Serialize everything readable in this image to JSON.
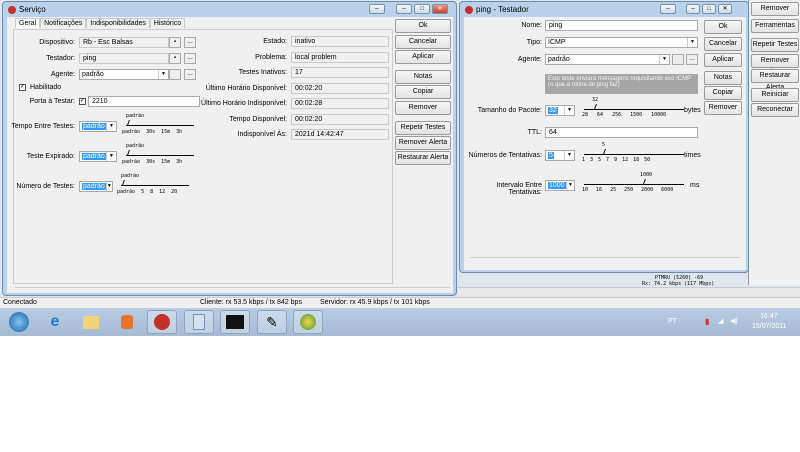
{
  "servico": {
    "title": "Serviço",
    "tabs": [
      "Geral",
      "Notificações",
      "Indisponibilidades",
      "Histórico"
    ],
    "dispositivo_label": "Dispositivo:",
    "dispositivo": "Rb - Esc Balsas",
    "testador_label": "Testador:",
    "testador": "ping",
    "agente_label": "Agente:",
    "agente": "padrão",
    "habilitado_label": "Habilitado",
    "porta_label": "Porta à Testar:",
    "porta": "2210",
    "tempo_label": "Tempo Entre Testes:",
    "tempo": "padrão",
    "tempo_marker": "padrão",
    "tempo_ticks": [
      "padrão",
      "30s",
      "15m",
      "3h"
    ],
    "expirado_label": "Teste Expirado:",
    "expirado": "padrão",
    "expirado_marker": "padrão",
    "expirado_ticks": [
      "padrão",
      "30s",
      "15m",
      "3h"
    ],
    "numero_label": "Número de Testes:",
    "numero": "padrão",
    "numero_marker": "padrão",
    "numero_ticks": [
      "padrão",
      "5",
      "8",
      "12",
      "20"
    ],
    "status": [
      {
        "label": "Estado:",
        "value": "inativo"
      },
      {
        "label": "Problema:",
        "value": "local problem"
      },
      {
        "label": "Testes Inativos:",
        "value": "17"
      },
      {
        "label": "Último Horário Disponível:",
        "value": "00:02:20"
      },
      {
        "label": "Último Horário Indisponível:",
        "value": "00:02:28"
      },
      {
        "label": "Tempo Disponível:",
        "value": "00:02:20"
      },
      {
        "label": "Indisponível Às:",
        "value": "2021d 14:42:47"
      }
    ],
    "buttons": [
      "Ok",
      "Cancelar",
      "Aplicar",
      "Notas",
      "Copiar",
      "Remover",
      "Repetir Testes",
      "Remover Alerta",
      "Restaurar Alerta"
    ]
  },
  "ping": {
    "title": "ping - Testador",
    "nome_label": "Nome:",
    "nome": "ping",
    "tipo_label": "Tipo:",
    "tipo": "ICMP",
    "agente_label": "Agente:",
    "agente": "padrão",
    "description": "Este teste enviará mensagens requisitando eco ICMP (o que a rotina de ping faz)",
    "pacote_label": "Tamanho do Pacote:",
    "pacote": "32",
    "pacote_marker": "32",
    "pacote_ticks": [
      "28",
      "64",
      "256",
      "1500",
      "10000"
    ],
    "pacote_unit": "bytes",
    "ttl_label": "TTL:",
    "ttl": "64",
    "tentativas_label": "Números de Tentativas:",
    "tentativas": "5",
    "tentativas_marker": "5",
    "tentativas_ticks": [
      "1",
      "3",
      "5",
      "7",
      "9",
      "12",
      "18",
      "50"
    ],
    "tentativas_unit": "times",
    "intervalo_label": "Intervalo Entre Tentativas:",
    "intervalo": "1000",
    "intervalo_marker": "1000",
    "intervalo_ticks": [
      "10",
      "16",
      "25",
      "250",
      "2000",
      "6000"
    ],
    "intervalo_unit": "ms",
    "buttons": [
      "Ok",
      "Cancelar",
      "Aplicar",
      "Notas",
      "Copiar",
      "Remover"
    ]
  },
  "back": {
    "buttons": [
      "Remover",
      "Ferramentas",
      "Repetir Testes",
      "Remover Alerta",
      "Restaurar Alerta",
      "Reiniciar",
      "Reconectar"
    ],
    "info1": "PTMRU (5260) -69",
    "info2": "Rx: 74.2 kbps (117 Mbps)"
  },
  "statusbar": {
    "conn": "Conectado",
    "cliente": "Cliente: rx 53.5 kbps / tx 842 bps",
    "servidor": "Servidor: rx 45.9 kbps / tx 101 kbps"
  },
  "taskbar": {
    "lang": "PT",
    "time": "16:47",
    "date": "15/07/2011"
  }
}
